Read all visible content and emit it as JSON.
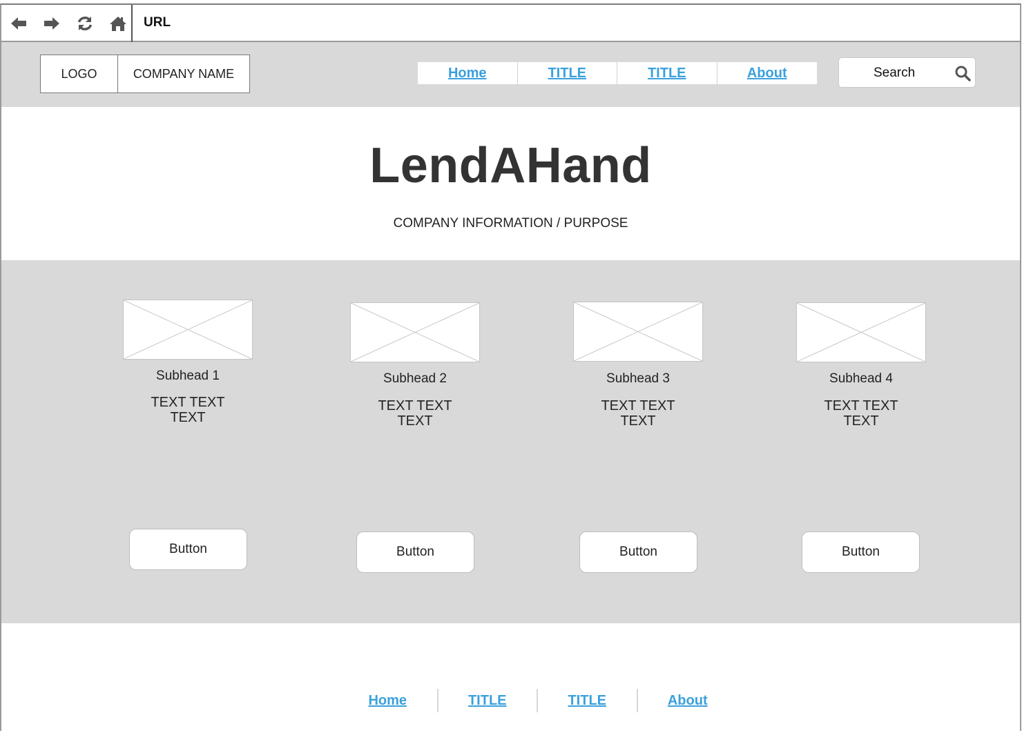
{
  "browser": {
    "url_label": "URL",
    "icons": [
      "back-arrow-icon",
      "forward-arrow-icon",
      "refresh-icon",
      "home-icon"
    ]
  },
  "header": {
    "logo": "LOGO",
    "company_name": "COMPANY NAME",
    "nav": [
      "Home",
      "TITLE",
      "TITLE",
      "About"
    ],
    "search_placeholder": "Search"
  },
  "hero": {
    "title": "LendAHand",
    "subtitle": "COMPANY INFORMATION / PURPOSE"
  },
  "features": [
    {
      "subhead": "Subhead 1",
      "text_line1": "TEXT TEXT",
      "text_line2": "TEXT",
      "button": "Button"
    },
    {
      "subhead": "Subhead 2",
      "text_line1": "TEXT TEXT",
      "text_line2": "TEXT",
      "button": "Button"
    },
    {
      "subhead": "Subhead 3",
      "text_line1": "TEXT TEXT",
      "text_line2": "TEXT",
      "button": "Button"
    },
    {
      "subhead": "Subhead 4",
      "text_line1": "TEXT TEXT",
      "text_line2": "TEXT",
      "button": "Button"
    }
  ],
  "footer": {
    "nav": [
      "Home",
      "TITLE",
      "TITLE",
      "About"
    ]
  },
  "colors": {
    "link": "#3aa0dd",
    "panel_gray": "#d9d9d9",
    "heading": "#333333"
  }
}
